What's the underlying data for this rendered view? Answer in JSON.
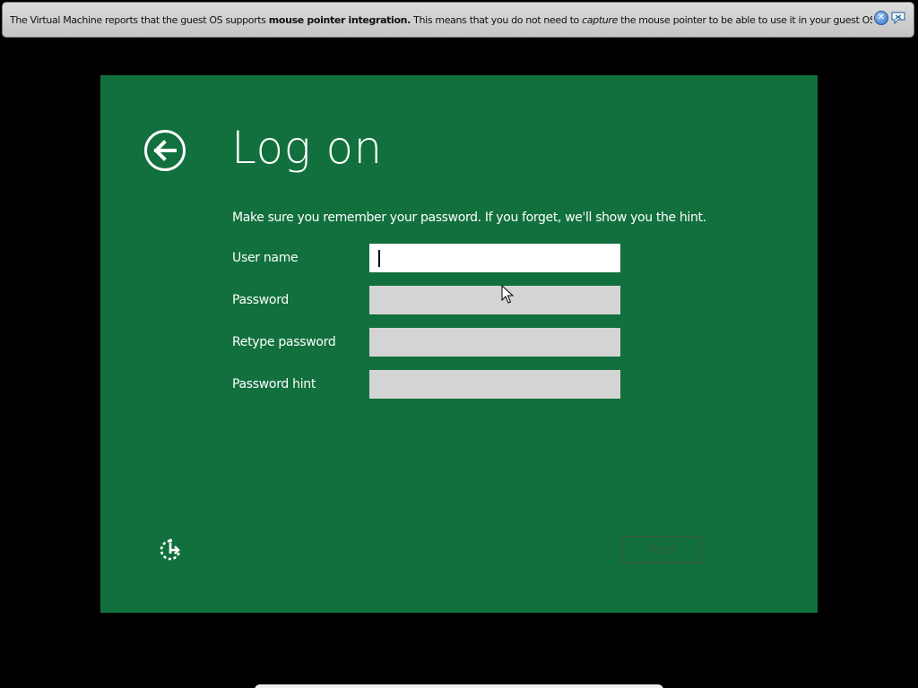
{
  "notification": {
    "text_prefix": "The Virtual Machine reports that the guest OS supports ",
    "text_bold": "mouse pointer integration.",
    "text_middle": " This means that you do not need to ",
    "text_italic": "capture",
    "text_suffix": " the mouse pointer to be able to use it in your guest OS -- all mouse",
    "icons": [
      "close-icon",
      "info-balloon-icon"
    ]
  },
  "setup": {
    "title": "Log on",
    "instruction": "Make sure you remember your password. If you forget, we'll show you the hint.",
    "fields": [
      {
        "label": "User name",
        "value": "",
        "active": true
      },
      {
        "label": "Password",
        "value": "",
        "active": false
      },
      {
        "label": "Retype password",
        "value": "",
        "active": false
      },
      {
        "label": "Password hint",
        "value": "",
        "active": false
      }
    ],
    "next_label": "Next",
    "icons": [
      "back-arrow-icon",
      "ease-of-access-icon"
    ]
  },
  "colors": {
    "setup_background": "#11703d",
    "input_inactive": "#d4d4d4",
    "input_active": "#ffffff",
    "notify_background": "#d0d0d0"
  }
}
